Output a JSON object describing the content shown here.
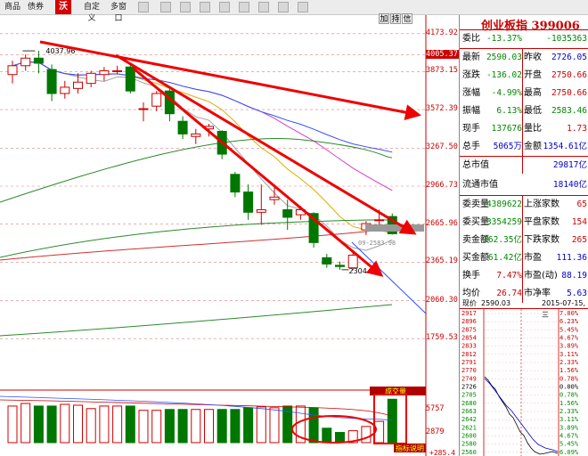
{
  "toolbar": {
    "items": [
      "商品",
      "债券",
      "自定义",
      "多窗口"
    ],
    "logo": "沃"
  },
  "chart_controls": {
    "add_label": "加",
    "hold_label": "持",
    "info_label": "信"
  },
  "price_axis": [
    "4173.92",
    "4005.37",
    "3873.15",
    "3572.39",
    "3267.50",
    "2966.73",
    "2665.96",
    "2365.19",
    "2060.30",
    "1759.53"
  ],
  "volume_axis": [
    "5757",
    "2879"
  ],
  "volume_label": "成交量",
  "indicator_label": "指标说明",
  "volume_bottom": "+285.4",
  "annotations": {
    "high": "4037.96",
    "low": "2304.76",
    "ref": "09-2583.98"
  },
  "panel": {
    "title": "创业板指 399006",
    "rows": [
      {
        "k": "委比",
        "v1": "-13.37%",
        "v2": "-1035363",
        "c": "grn"
      },
      {
        "k": "最新",
        "v1": "2590.03",
        "k2": "昨收",
        "v2": "2726.05",
        "c1": "grn",
        "c2": "blu"
      },
      {
        "k": "涨跌",
        "v1": "-136.02",
        "k2": "开盘",
        "v2": "2750.66",
        "c1": "grn",
        "c2": "red"
      },
      {
        "k": "涨幅",
        "v1": "-4.99%",
        "k2": "最高",
        "v2": "2750.66",
        "c1": "grn",
        "c2": "red"
      },
      {
        "k": "振幅",
        "v1": "6.13%",
        "k2": "最低",
        "v2": "2583.46",
        "c1": "grn",
        "c2": "grn"
      },
      {
        "k": "现手",
        "v1": "137676",
        "k2": "量比",
        "v2": "1.73",
        "c1": "grn",
        "c2": "red"
      },
      {
        "k": "总手",
        "v1": "5065万",
        "k2": "金额",
        "v2": "1354.61亿",
        "c1": "blu",
        "c2": "blu"
      }
    ],
    "caps": [
      {
        "k": "总市值",
        "v": "29817亿"
      },
      {
        "k": "流通市值",
        "v": "18140亿"
      }
    ],
    "book": [
      {
        "k": "委卖量",
        "v1": "4389622",
        "k2": "上涨家数",
        "v2": "65",
        "c1": "grn",
        "c2": "red"
      },
      {
        "k": "委买量",
        "v1": "3354259",
        "k2": "平盘家数",
        "v2": "154",
        "c1": "grn",
        "c2": "red"
      },
      {
        "k": "卖金额",
        "v1": "162.35亿",
        "k2": "下跌家数",
        "v2": "265",
        "c1": "grn",
        "c2": "red"
      },
      {
        "k": "买金额",
        "v1": "61.42亿",
        "k2": "市盈",
        "v2": "111.36",
        "c1": "grn",
        "c2": "blu"
      },
      {
        "k": "换手",
        "v1": "7.47%",
        "k2": "市盈(动)",
        "v2": "88.19",
        "c1": "red",
        "c2": "blu"
      },
      {
        "k": "均价",
        "v1": "26.74",
        "k2": "市净率",
        "v2": "5.63",
        "c1": "red",
        "c2": "blu"
      }
    ],
    "mini": {
      "label": "现价",
      "price": "2590.03",
      "date": "2015-07-15,三",
      "left_axis": [
        "2917",
        "2896",
        "2875",
        "2854",
        "2833",
        "2812",
        "2791",
        "2770",
        "2749",
        "2726",
        "2705",
        "2680",
        "2663",
        "2642",
        "2621",
        "2600",
        "2580",
        "2560"
      ],
      "right_axis": [
        "7.00%",
        "6.23%",
        "5.45%",
        "4.67%",
        "3.89%",
        "3.11%",
        "2.33%",
        "1.56%",
        "0.78%",
        "0.00%",
        "0.78%",
        "1.56%",
        "2.33%",
        "3.11%",
        "3.89%",
        "4.67%",
        "5.45%",
        "6.09%"
      ]
    }
  },
  "colors": {
    "up": "#cc0000",
    "down": "#007700",
    "arrow": "#ee0000",
    "ma5": "#ffffff",
    "ma10": "#d8b000",
    "ma20": "#d040d0",
    "ma30": "#2a8a2a",
    "ma60": "#3050ff"
  },
  "chart_data": {
    "type": "candlestick",
    "candles": [
      {
        "o": 3850,
        "c": 3920,
        "h": 3960,
        "l": 3780
      },
      {
        "o": 3920,
        "c": 3980,
        "h": 4010,
        "l": 3880
      },
      {
        "o": 3980,
        "c": 3940,
        "h": 4037.96,
        "l": 3860
      },
      {
        "o": 3890,
        "c": 3700,
        "h": 3930,
        "l": 3640
      },
      {
        "o": 3700,
        "c": 3750,
        "h": 3800,
        "l": 3660
      },
      {
        "o": 3740,
        "c": 3790,
        "h": 3860,
        "l": 3700
      },
      {
        "o": 3780,
        "c": 3860,
        "h": 3880,
        "l": 3750
      },
      {
        "o": 3850,
        "c": 3880,
        "h": 3910,
        "l": 3800
      },
      {
        "o": 3880,
        "c": 3880,
        "h": 3920,
        "l": 3850
      },
      {
        "o": 3910,
        "c": 3720,
        "h": 3940,
        "l": 3700
      },
      {
        "o": 3580,
        "c": 3580,
        "h": 3630,
        "l": 3480
      },
      {
        "o": 3600,
        "c": 3700,
        "h": 3720,
        "l": 3560
      },
      {
        "o": 3720,
        "c": 3540,
        "h": 3740,
        "l": 3480
      },
      {
        "o": 3480,
        "c": 3380,
        "h": 3520,
        "l": 3340
      },
      {
        "o": 3360,
        "c": 3380,
        "h": 3420,
        "l": 3300
      },
      {
        "o": 3420,
        "c": 3440,
        "h": 3460,
        "l": 3360
      },
      {
        "o": 3400,
        "c": 3220,
        "h": 3410,
        "l": 3180
      },
      {
        "o": 3060,
        "c": 2920,
        "h": 3080,
        "l": 2880
      },
      {
        "o": 2920,
        "c": 2760,
        "h": 2980,
        "l": 2700
      },
      {
        "o": 2760,
        "c": 2780,
        "h": 2980,
        "l": 2660
      },
      {
        "o": 2860,
        "c": 2880,
        "h": 2980,
        "l": 2820
      },
      {
        "o": 2780,
        "c": 2720,
        "h": 2860,
        "l": 2620
      },
      {
        "o": 2740,
        "c": 2780,
        "h": 2810,
        "l": 2700
      },
      {
        "o": 2750,
        "c": 2520,
        "h": 2760,
        "l": 2480
      },
      {
        "o": 2400,
        "c": 2350,
        "h": 2430,
        "l": 2320
      },
      {
        "o": 2340,
        "c": 2330,
        "h": 2370,
        "l": 2304.76
      },
      {
        "o": 2320,
        "c": 2420,
        "h": 2440,
        "l": 2300
      },
      {
        "o": 2620,
        "c": 2670,
        "h": 2690,
        "l": 2580
      },
      {
        "o": 2700,
        "c": 2700,
        "h": 2780,
        "l": 2660
      },
      {
        "o": 2726,
        "c": 2590,
        "h": 2750,
        "l": 2583
      }
    ],
    "volumes": [
      4300,
      4600,
      4300,
      4300,
      4500,
      4400,
      4000,
      4300,
      4300,
      4300,
      3800,
      3800,
      3900,
      3900,
      3900,
      3900,
      3900,
      3900,
      4100,
      4200,
      4100,
      4300,
      4300,
      4100,
      1700,
      1200,
      1400,
      1900,
      2500,
      5100
    ],
    "ylim": [
      1500,
      4250
    ]
  }
}
